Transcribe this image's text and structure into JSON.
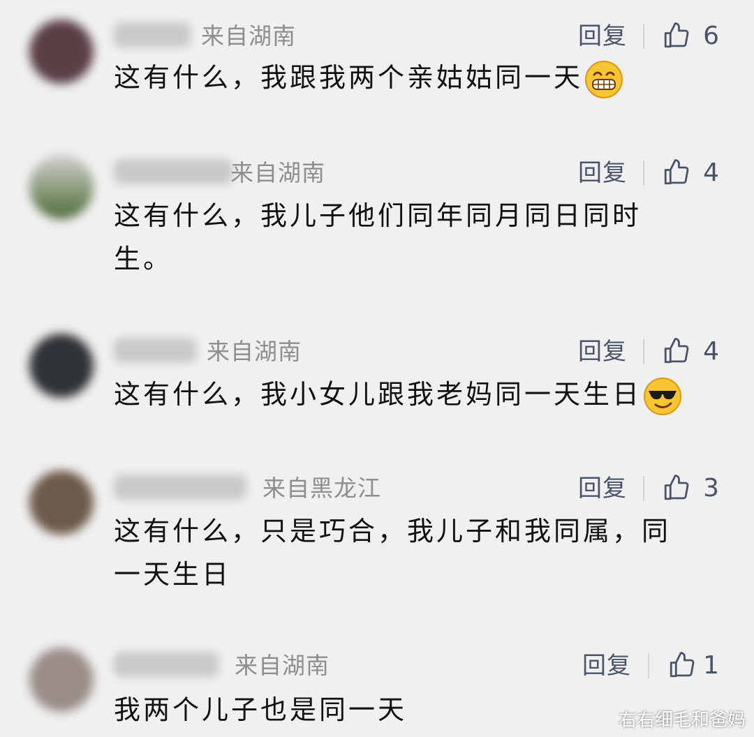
{
  "ui": {
    "reply_label": "回复"
  },
  "comments": [
    {
      "location": "来自湖南",
      "likes": "6",
      "text": "这有什么，我跟我两个亲姑姑同一天",
      "text_line2": "",
      "emoji": "grin-icon"
    },
    {
      "location": "来自湖南",
      "likes": "4",
      "text": "这有什么，我儿子他们同年同月同日同时",
      "text_line2": "生。",
      "emoji": ""
    },
    {
      "location": "来自湖南",
      "likes": "4",
      "text": "这有什么，我小女儿跟我老妈同一天生日",
      "text_line2": "",
      "emoji": "sunglasses-icon"
    },
    {
      "location": "来自黑龙江",
      "likes": "3",
      "text": "这有什么，只是巧合，我儿子和我同属，同",
      "text_line2": "一天生日",
      "emoji": ""
    },
    {
      "location": "来自湖南",
      "likes": "1",
      "text": "我两个儿子也是同一天",
      "text_line2": "",
      "emoji": ""
    }
  ],
  "watermark": "右右细毛和爸妈",
  "colors": {
    "background": "#f0f0f0",
    "location_text": "#8e8e8e",
    "action_text": "#4a5468",
    "body_text": "#111111"
  }
}
